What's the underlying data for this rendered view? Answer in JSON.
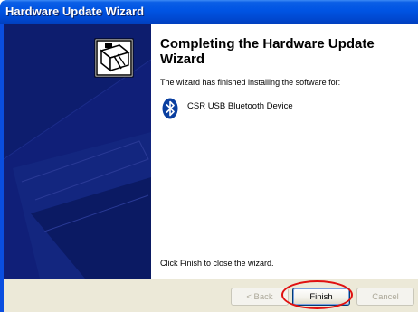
{
  "window": {
    "title": "Hardware Update Wizard"
  },
  "content": {
    "heading": "Completing the Hardware Update Wizard",
    "subtext": "The wizard has finished installing the software for:",
    "device_name": "CSR USB Bluetooth Device",
    "close_instruction": "Click Finish to close the wizard."
  },
  "buttons": {
    "back_label": "< Back",
    "finish_label": "Finish",
    "cancel_label": "Cancel"
  },
  "icons": {
    "wizard_icon": "hardware-box-icon",
    "device_icon": "bluetooth-icon"
  },
  "colors": {
    "titlebar": "#0054e3",
    "sidepanel": "#0d1d6e",
    "highlight": "#e01010",
    "bluetooth": "#0a3fa0"
  }
}
